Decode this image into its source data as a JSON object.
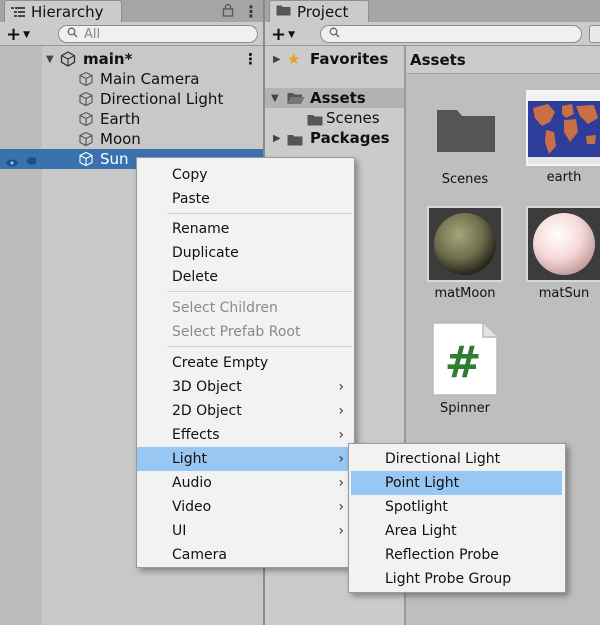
{
  "hierarchy": {
    "tab_label": "Hierarchy",
    "search_placeholder": "All",
    "scene_name": "main*",
    "items": [
      "Main Camera",
      "Directional Light",
      "Earth",
      "Moon",
      "Sun"
    ],
    "selected": "Sun"
  },
  "project": {
    "tab_label": "Project",
    "sidebar": {
      "favorites": "Favorites",
      "assets": "Assets",
      "scenes": "Scenes",
      "packages": "Packages"
    },
    "assets_header": "Assets",
    "assets": [
      {
        "name": "Scenes",
        "type": "folder"
      },
      {
        "name": "earth",
        "type": "texture"
      },
      {
        "name": "matMoon",
        "type": "material",
        "color": "#6e6e4c"
      },
      {
        "name": "matSun",
        "type": "material",
        "color": "#f6d8d8"
      },
      {
        "name": "Spinner",
        "type": "script"
      }
    ]
  },
  "context_menu": {
    "items": [
      {
        "label": "Copy"
      },
      {
        "label": "Paste"
      },
      {
        "label": "Rename"
      },
      {
        "label": "Duplicate"
      },
      {
        "label": "Delete"
      },
      {
        "label": "Select Children",
        "disabled": true
      },
      {
        "label": "Select Prefab Root",
        "disabled": true
      },
      {
        "label": "Create Empty"
      },
      {
        "label": "3D Object",
        "submenu": true
      },
      {
        "label": "2D Object",
        "submenu": true
      },
      {
        "label": "Effects",
        "submenu": true
      },
      {
        "label": "Light",
        "submenu": true,
        "highlighted": true
      },
      {
        "label": "Audio",
        "submenu": true
      },
      {
        "label": "Video",
        "submenu": true
      },
      {
        "label": "UI",
        "submenu": true
      },
      {
        "label": "Camera"
      }
    ]
  },
  "light_submenu": {
    "items": [
      "Directional Light",
      "Point Light",
      "Spotlight",
      "Area Light",
      "Reflection Probe",
      "Light Probe Group"
    ],
    "highlighted": "Point Light"
  },
  "colors": {
    "selection": "#3a72b0",
    "menu_highlight": "#98c7f3",
    "script_green": "#2e7d32"
  }
}
